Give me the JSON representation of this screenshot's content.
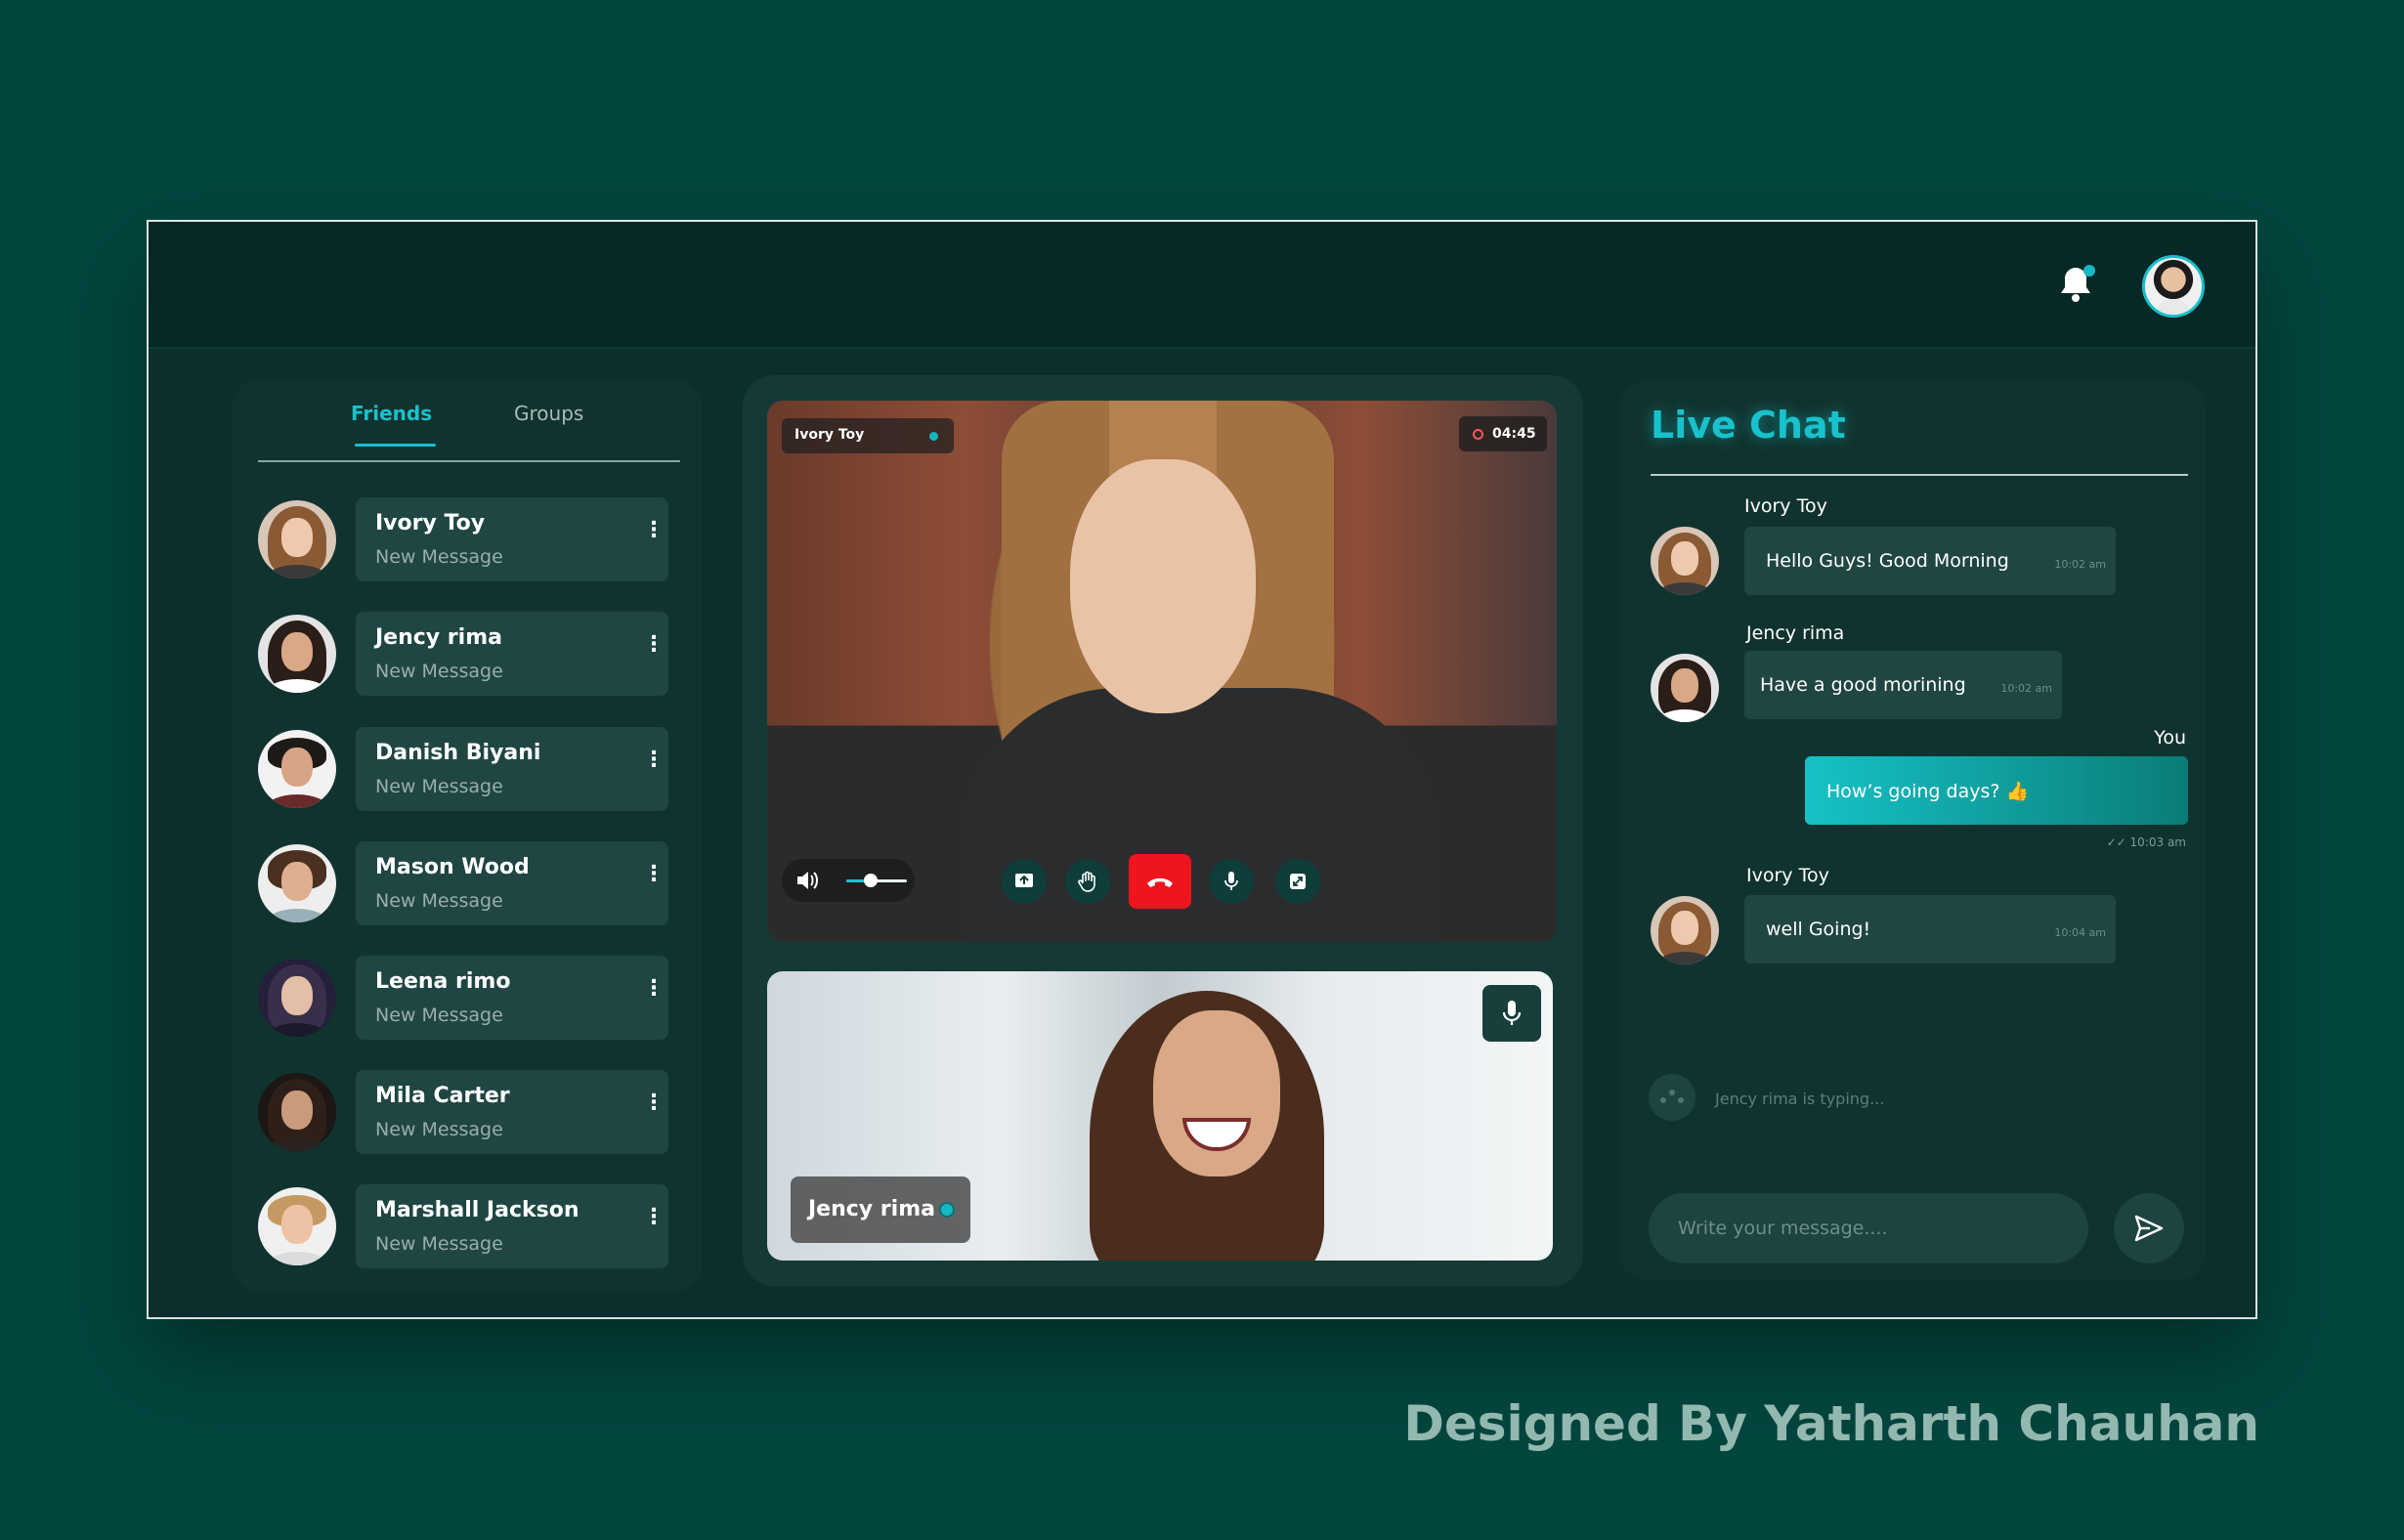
{
  "header": {
    "notification_icon": "bell-icon",
    "profile_icon": "user-avatar"
  },
  "friends_panel": {
    "tabs": [
      {
        "label": "Friends",
        "active": true
      },
      {
        "label": "Groups",
        "active": false
      }
    ],
    "items": [
      {
        "name": "Ivory Toy",
        "subtitle": "New Message"
      },
      {
        "name": "Jency rima",
        "subtitle": "New Message"
      },
      {
        "name": "Danish Biyani",
        "subtitle": "New Message"
      },
      {
        "name": "Mason Wood",
        "subtitle": "New Message"
      },
      {
        "name": "Leena rimo",
        "subtitle": "New Message"
      },
      {
        "name": "Mila Carter",
        "subtitle": "New Message"
      },
      {
        "name": "Marshall Jackson",
        "subtitle": "New Message"
      }
    ],
    "menu_icon": "more-vertical-icon"
  },
  "video_call": {
    "main": {
      "participant": "Ivory Toy",
      "timer": "04:45",
      "volume_level": 0.4
    },
    "controls": [
      "share-screen-icon",
      "raise-hand-icon",
      "end-call-icon",
      "microphone-icon",
      "fullscreen-icon"
    ],
    "secondary": {
      "participant": "Jency rima"
    }
  },
  "chat": {
    "title": "Live Chat",
    "messages": [
      {
        "sender": "Ivory Toy",
        "text": "Hello Guys!  Good Morning",
        "time": "10:02 am"
      },
      {
        "sender": "Jency rima",
        "text": "Have a good morining",
        "time": "10:02 am"
      },
      {
        "sender": "You",
        "text": "How’s going days? 👍",
        "time": "10:03 am"
      },
      {
        "sender": "Ivory Toy",
        "text": "well Going!",
        "time": "10:04 am"
      }
    ],
    "typing_text": "Jency rima is typing...",
    "input_placeholder": "Write your message....",
    "send_icon": "send-icon"
  },
  "credit": "Designed By Yatharth Chauhan",
  "colors": {
    "background": "#03463e",
    "panel": "#11332f",
    "accent": "#18c2cc",
    "end_call": "#f0141f"
  }
}
